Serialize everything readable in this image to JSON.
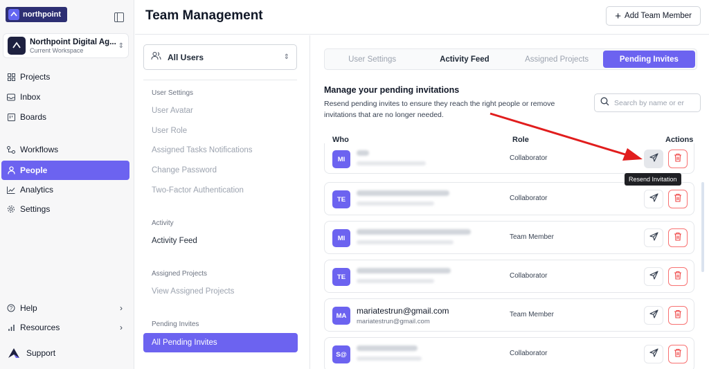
{
  "brand": {
    "logo_text": "northpoint"
  },
  "workspace": {
    "name": "Northpoint Digital Ag...",
    "subtitle": "Current Workspace"
  },
  "sidebar": {
    "items": [
      {
        "label": "Projects",
        "icon": "grid-icon"
      },
      {
        "label": "Inbox",
        "icon": "inbox-icon"
      },
      {
        "label": "Boards",
        "icon": "board-icon"
      },
      {
        "label": "Workflows",
        "icon": "workflow-icon"
      },
      {
        "label": "People",
        "icon": "user-icon",
        "active": true
      },
      {
        "label": "Analytics",
        "icon": "chart-icon"
      },
      {
        "label": "Settings",
        "icon": "gear-icon"
      }
    ],
    "bottom": [
      {
        "label": "Help",
        "icon": "help-icon"
      },
      {
        "label": "Resources",
        "icon": "bars-icon"
      },
      {
        "label": "Support",
        "icon": "support-logo"
      }
    ]
  },
  "header": {
    "title": "Team Management",
    "add_button": "Add Team Member"
  },
  "subpanel": {
    "selector": "All Users",
    "sections": [
      {
        "title": "User Settings",
        "items": [
          "User Avatar",
          "User Role",
          "Assigned Tasks Notifications",
          "Change Password",
          "Two-Factor Authentication"
        ]
      },
      {
        "title": "Activity",
        "items": [
          "Activity Feed"
        ]
      },
      {
        "title": "Assigned Projects",
        "items": [
          "View Assigned Projects"
        ]
      },
      {
        "title": "Pending Invites",
        "items": [
          "All Pending Invites"
        ]
      }
    ]
  },
  "tabs": [
    "User Settings",
    "Activity Feed",
    "Assigned Projects",
    "Pending Invites"
  ],
  "main": {
    "title": "Manage your pending invitations",
    "description": "Resend pending invites to ensure they reach the right people or remove invitations that are no longer needed.",
    "search_placeholder": "Search by name or er",
    "columns": {
      "who": "Who",
      "role": "Role",
      "actions": "Actions"
    },
    "tooltip": "Resend Invitation",
    "rows": [
      {
        "initials": "MI",
        "role": "Collaborator"
      },
      {
        "initials": "TE",
        "role": "Collaborator"
      },
      {
        "initials": "MI",
        "role": "Team Member"
      },
      {
        "initials": "TE",
        "role": "Collaborator"
      },
      {
        "initials": "MA",
        "email": "mariatestrun@gmail.com",
        "email_sub": "mariatestrun@gmail.com",
        "role": "Team Member"
      },
      {
        "initials": "S@",
        "role": "Collaborator"
      }
    ]
  },
  "colors": {
    "accent": "#6c63f0",
    "danger": "#ef4444",
    "arrow": "#e11d1d"
  }
}
